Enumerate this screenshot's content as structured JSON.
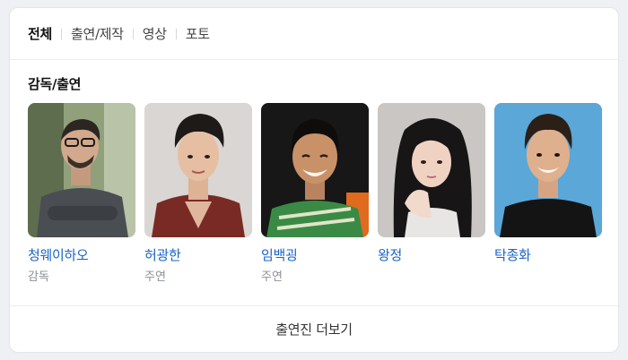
{
  "tabs": [
    {
      "label": "전체",
      "active": true
    },
    {
      "label": "출연/제작",
      "active": false
    },
    {
      "label": "영상",
      "active": false
    },
    {
      "label": "포토",
      "active": false
    }
  ],
  "section": {
    "title": "감독/출연"
  },
  "people": [
    {
      "name": "청웨이하오",
      "role": "감독"
    },
    {
      "name": "허광한",
      "role": "주연"
    },
    {
      "name": "임백굉",
      "role": "주연"
    },
    {
      "name": "왕정",
      "role": ""
    },
    {
      "name": "탁종화",
      "role": ""
    }
  ],
  "more": {
    "label": "출연진 더보기"
  },
  "colors": {
    "link": "#1a63c7",
    "muted": "#8b8f95",
    "background": "#eef0f3"
  }
}
